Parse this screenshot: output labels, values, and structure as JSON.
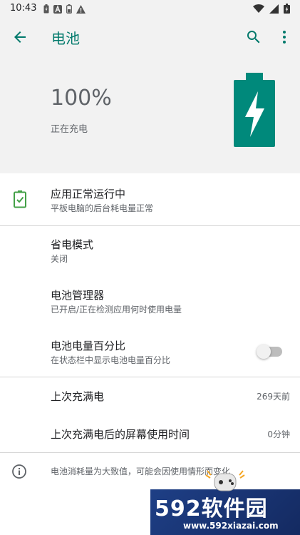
{
  "status_bar": {
    "time": "10:43",
    "left_icons": [
      "battery-saver-icon",
      "a-badge-icon",
      "battery-small-icon",
      "warning-icon"
    ],
    "right_icons": [
      "wifi-icon",
      "signal-icon",
      "battery-icon"
    ]
  },
  "app_bar": {
    "title": "电池",
    "back_icon": "arrow-back-icon",
    "search_icon": "search-icon",
    "more_icon": "more-vert-icon"
  },
  "header": {
    "battery_level": "100%",
    "charge_status": "正在充电",
    "battery_icon": "battery-charging-icon",
    "battery_fill": 1.0
  },
  "health": {
    "title": "应用正常运行中",
    "subtitle": "平板电脑的后台耗电量正常",
    "icon": "battery-check-icon"
  },
  "settings": {
    "saver": {
      "title": "省电模式",
      "subtitle": "关闭"
    },
    "manager": {
      "title": "电池管理器",
      "subtitle": "已开启/正在检测应用何时使用电量"
    },
    "percentage": {
      "title": "电池电量百分比",
      "subtitle": "在状态栏中显示电池电量百分比",
      "enabled": false
    }
  },
  "stats": {
    "last_full_charge": {
      "title": "上次充满电",
      "value": "269天前"
    },
    "screen_usage": {
      "title": "上次充满电后的屏幕使用时间",
      "value": "0分钟"
    }
  },
  "footer": {
    "info_icon": "info-icon",
    "text": "电池消耗量为大致值，可能会因使用情形而变化"
  },
  "watermark": {
    "brand": "592软件园",
    "url": "www.592xiazai.com"
  },
  "colors": {
    "accent": "#00796b",
    "battery": "#00897b",
    "check": "#43a047",
    "header_bg": "#f2f2f2"
  }
}
